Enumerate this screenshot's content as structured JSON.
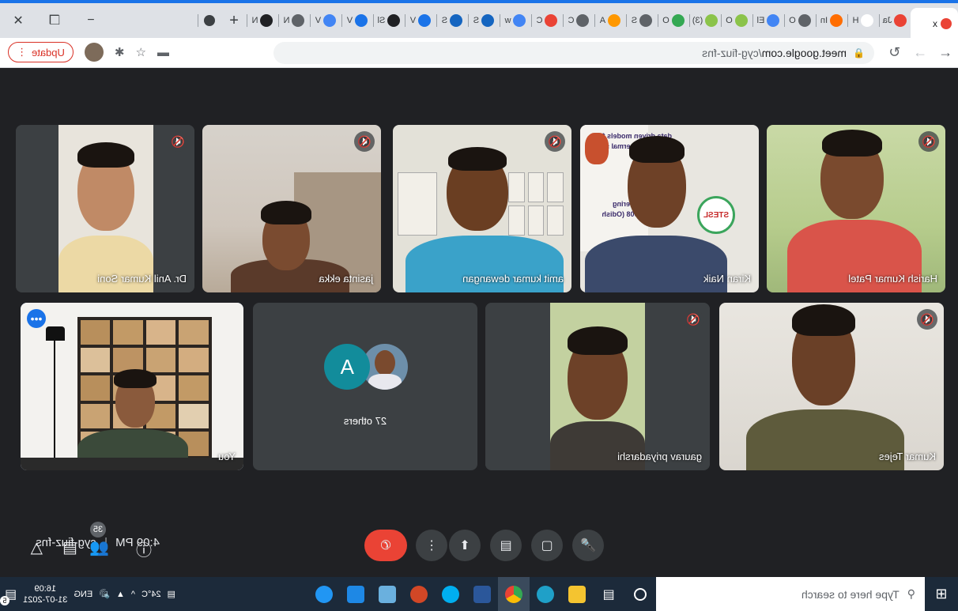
{
  "browser": {
    "tabs": [
      {
        "label": "Ja",
        "favicon_color": "#ea4335"
      },
      {
        "label": "H",
        "favicon_color": "#ffffff"
      },
      {
        "label": "In",
        "favicon_color": "#ff6d00"
      },
      {
        "label": "O",
        "favicon_color": "#5f6368"
      },
      {
        "label": "El",
        "favicon_color": "#4285f4"
      },
      {
        "label": "O",
        "favicon_color": "#8bc34a"
      },
      {
        "label": "(3)",
        "favicon_color": "#8bc34a"
      },
      {
        "label": "O",
        "favicon_color": "#34a853"
      },
      {
        "label": "S",
        "favicon_color": "#5f6368"
      },
      {
        "label": "A",
        "favicon_color": "#ff9800"
      },
      {
        "label": "C",
        "favicon_color": "#5f6368"
      },
      {
        "label": "C",
        "favicon_color": "#ea4335"
      },
      {
        "label": "w",
        "favicon_color": "#4285f4"
      },
      {
        "label": "S",
        "favicon_color": "#1565c0"
      },
      {
        "label": "S",
        "favicon_color": "#1565c0"
      },
      {
        "label": "V",
        "favicon_color": "#1a73e8"
      },
      {
        "label": "Sl",
        "favicon_color": "#202124"
      },
      {
        "label": "V",
        "favicon_color": "#1a73e8"
      },
      {
        "label": "V",
        "favicon_color": "#4285f4"
      },
      {
        "label": "N",
        "favicon_color": "#5f6368"
      },
      {
        "label": "N",
        "favicon_color": "#202124"
      }
    ],
    "active_tab": {
      "label": "x",
      "favicon_color": "#ea4335"
    },
    "new_tab": "+",
    "window_controls": {
      "minimize": "−",
      "restore": "❐",
      "close": "✕"
    },
    "address": {
      "host": "meet.google.com",
      "path": "/cyg-fiuz-fns"
    },
    "update_label": "Update",
    "icons": [
      "back-icon",
      "forward-icon",
      "reload-icon",
      "lock-icon",
      "cast-icon",
      "star-icon",
      "extensions-icon",
      "profile-icon",
      "menu-icon"
    ]
  },
  "meet": {
    "participants": [
      {
        "name": "Harish Kumar Patel",
        "muted": true
      },
      {
        "name": "Kiran Naik",
        "muted": true
      },
      {
        "name": "amit kumar dewangan",
        "muted": true
      },
      {
        "name": "jasinta ekka",
        "muted": true
      },
      {
        "name": "Dr. Anil Kumar Soni",
        "muted": true
      },
      {
        "name": "Kumar Tejes",
        "muted": true
      },
      {
        "name": "gaurav priyadarshi",
        "muted": true
      },
      {
        "name": "You",
        "muted": false
      }
    ],
    "others": {
      "label": "27 others",
      "avatar_letter": "A",
      "avatar_color": "#128c9b"
    },
    "poster_text": [
      "data driven models fo",
      "nalysis of thermal sy",
      "nical Engineering",
      "kela – 769008 (Odish",
      "STESL"
    ],
    "meeting_code": "cyg-fiuz-fns",
    "time": "4:09 PM",
    "separator": "|",
    "people_count": "35",
    "accent": "#8ab4f8",
    "end_call_color": "#ea4335"
  },
  "taskbar": {
    "search_placeholder": "Type here to search",
    "weather": "24°C",
    "language": "ENG",
    "time": "16:09",
    "date": "31-07-2021",
    "notification_count": "5"
  }
}
